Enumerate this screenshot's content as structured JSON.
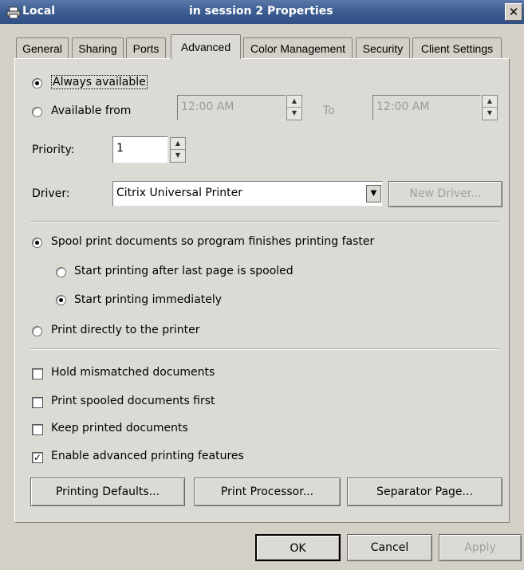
{
  "window": {
    "title_app": "Local",
    "title": "in session 2 Properties",
    "close_glyph": "✕"
  },
  "tabs": [
    "General",
    "Sharing",
    "Ports",
    "Advanced",
    "Color Management",
    "Security",
    "Client Settings"
  ],
  "availability": {
    "always_label": "Always available",
    "from_label": "Available from",
    "from_time": "12:00 AM",
    "to_label": "To",
    "to_time": "12:00 AM",
    "always_selected": true
  },
  "priority": {
    "label": "Priority:",
    "value": "1"
  },
  "driver": {
    "label": "Driver:",
    "value": "Citrix Universal Printer",
    "new_driver": "New Driver..."
  },
  "spooling": {
    "spool_label": "Spool print documents so program finishes printing faster",
    "after_last_page": "Start printing after last page is spooled",
    "immediately": "Start printing immediately",
    "direct": "Print directly to the printer"
  },
  "options": [
    {
      "label": "Hold mismatched documents",
      "checked": false
    },
    {
      "label": "Print spooled documents first",
      "checked": false
    },
    {
      "label": "Keep printed documents",
      "checked": false
    },
    {
      "label": "Enable advanced printing features",
      "checked": true
    }
  ],
  "buttons": {
    "printing_defaults": "Printing Defaults...",
    "print_processor": "Print Processor...",
    "separator_page": "Separator Page...",
    "ok": "OK",
    "cancel": "Cancel",
    "apply": "Apply"
  }
}
